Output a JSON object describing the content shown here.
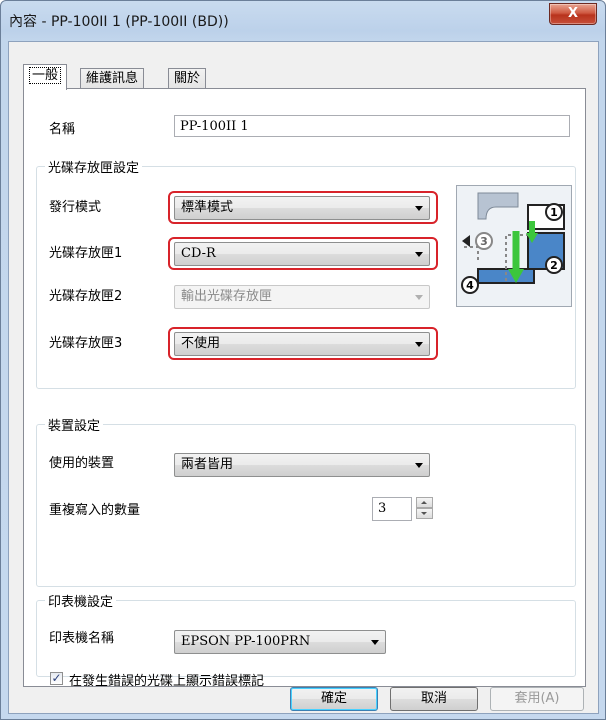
{
  "window": {
    "title": "內容 - PP-100II 1 (PP-100II (BD))",
    "close_glyph": "X"
  },
  "tabs": [
    {
      "label": "一般",
      "active": true
    },
    {
      "label": "維護訊息",
      "active": false
    },
    {
      "label": "關於",
      "active": false
    }
  ],
  "general": {
    "name_label": "名稱",
    "name_value": "PP-100II 1"
  },
  "disc_stacker": {
    "group_title": "光碟存放匣設定",
    "mode_label": "發行模式",
    "mode_value": "標準模式",
    "stacker1_label": "光碟存放匣1",
    "stacker1_value": "CD-R",
    "stacker2_label": "光碟存放匣2",
    "stacker2_value": "輸出光碟存放匣",
    "stacker3_label": "光碟存放匣3",
    "stacker3_value": "不使用",
    "diagram_numbers": [
      "1",
      "2",
      "3",
      "4"
    ]
  },
  "device": {
    "group_title": "裝置設定",
    "device_label": "使用的裝置",
    "device_value": "兩者皆用",
    "copies_label": "重複寫入的數量",
    "copies_value": "3"
  },
  "printer": {
    "group_title": "印表機設定",
    "printer_label": "印表機名稱",
    "printer_value": "EPSON PP-100PRN",
    "error_mark_label": "在發生錯誤的光碟上顯示錯誤標記",
    "error_mark_checked": true,
    "check_glyph": "✓"
  },
  "buttons": {
    "ok": "確定",
    "cancel": "取消",
    "apply": "套用(A)"
  },
  "colors": {
    "highlight_red": "#d8232a",
    "diagram_green": "#3cc63c",
    "diagram_blue": "#4a86c8"
  }
}
